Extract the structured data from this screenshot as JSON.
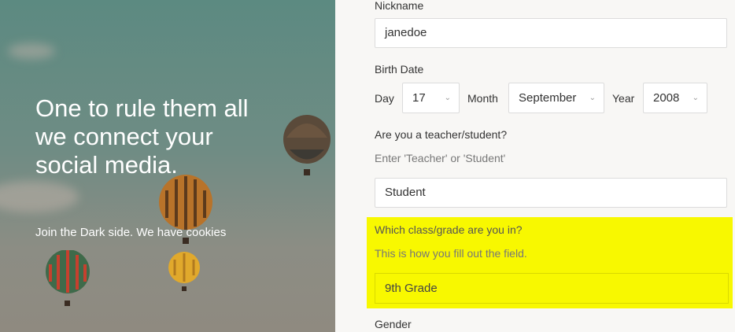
{
  "hero": {
    "headline": "One to rule them all we connect your social media.",
    "subline": "Join the Dark side. We have cookies"
  },
  "form": {
    "nickname": {
      "label": "Nickname",
      "value": "janedoe"
    },
    "birth_date": {
      "label": "Birth Date",
      "day_label": "Day",
      "day_value": "17",
      "month_label": "Month",
      "month_value": "September",
      "year_label": "Year",
      "year_value": "2008"
    },
    "role": {
      "label": "Are you a teacher/student?",
      "hint": "Enter 'Teacher' or 'Student'",
      "value": "Student"
    },
    "grade": {
      "label": "Which class/grade are you in?",
      "hint": "This is how you fill out the field.",
      "value": "9th Grade"
    },
    "gender": {
      "label": "Gender"
    }
  },
  "colors": {
    "highlight": "#f8f800"
  },
  "icons": {
    "select_chevron": "chevron-down-icon"
  }
}
